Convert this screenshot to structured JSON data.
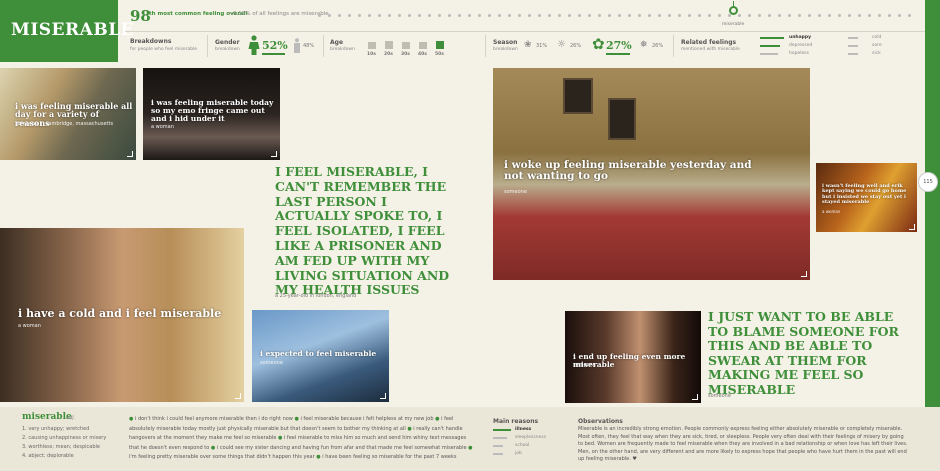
{
  "header": {
    "title": "MISERABLE",
    "rank_number": "98",
    "rank_text": "th most common feeling overall",
    "rank_pct": "• 0.13% of all feelings are miserable",
    "marker_label": "miserable",
    "breakdowns_title": "Breakdowns",
    "breakdowns_sub": "for people who feel miserable",
    "gender_title": "Gender",
    "gender_sub": "breakdown",
    "female_pct": "52%",
    "male_pct": "48%",
    "age_title": "Age",
    "age_sub": "breakdown",
    "age_labels": [
      "10s",
      "20s",
      "30s",
      "40s",
      "50s"
    ],
    "season_title": "Season",
    "season_sub": "breakdown",
    "season_pcts": [
      "31%",
      "26%",
      "27%",
      "26%"
    ],
    "related_title": "Related feelings",
    "related_sub": "mentioned with miserable",
    "related_col1": [
      "unhappy",
      "depressed",
      "hopeless"
    ],
    "related_col2": [
      "cold",
      "sore",
      "sick"
    ]
  },
  "photos": [
    {
      "caption": "i was feeling miserable all day for a variety of reasons",
      "by": "someone in cambridge, massachusetts"
    },
    {
      "caption": "i was feeling miserable today so my emo fringe came out and i hid under it",
      "by": "a woman"
    },
    {
      "caption": "i woke up feeling miserable yesterday and not wanting to go",
      "by": "someone"
    },
    {
      "caption": "i wasn't feeling well and erik kept saying we could go home but i insisted we stay out yet i stayed miserable",
      "by": "a woman"
    },
    {
      "caption": "i have a cold and i feel miserable",
      "by": "a woman"
    },
    {
      "caption": "i expected to feel miserable",
      "by": "someone"
    },
    {
      "caption": "i end up feeling even more miserable",
      "by": "someone"
    }
  ],
  "quotes": [
    {
      "text": "I FEEL MISERABLE, I CAN'T REMEMBER THE LAST PERSON I ACTUALLY SPOKE TO, I FEEL ISOLATED, I FEEL LIKE A PRISONER AND AM FED UP WITH MY LIVING SITUATION AND MY HEALTH ISSUES",
      "by": "a 25-year-old in london, england"
    },
    {
      "text": "I JUST WANT TO BE ABLE TO BLAME SOMEONE FOR THIS AND BE ABLE TO SWEAR AT THEM FOR MAKING ME FEEL SO MISERABLE",
      "by": "someone"
    }
  ],
  "page_number": "115",
  "footer": {
    "word": "miserable",
    "pos": "adj.",
    "definitions": [
      "1. very unhappy; wretched",
      "2. causing unhappiness or misery",
      "3. worthless; mean; despicable",
      "4. abject; deplorable"
    ],
    "stream": [
      "i don't think i could feel anymore miserable then i do right now",
      "i feel miserable because i felt helpless at my new job",
      "i feel absolutely miserable today mostly just physically miserable but that doesn't seem to bother my thinking at all",
      "i really can't handle hangovers at the moment they make me feel so miserable",
      "i feel miserable to miss him so much and send him whiny text messages that he doesn't even respond to",
      "i could see my sister dancing and having fun from afar and that made me feel somewhat miserable",
      "i'm feeling pretty miserable over some things that didn't happen this year",
      "i have been feeling so miserable for the past 7 weeks"
    ],
    "reasons_title": "Main reasons",
    "reasons": [
      "illness",
      "sleeplessness",
      "school",
      "job"
    ],
    "observations_title": "Observations",
    "observations": "Miserable is an incredibly strong emotion. People commonly express feeling either absolutely miserable or completely miserable. Most often, they feel that way when they are sick, tired, or sleepless. People very often deal with their feelings of misery by going to bed. Women are frequently made to feel miserable when they are involved in a bad relationship or when love has left their lives. Men, on the other hand, are very different and are more likely to express hope that people who have hurt them in the past will end up feeling miserable. ♥"
  }
}
